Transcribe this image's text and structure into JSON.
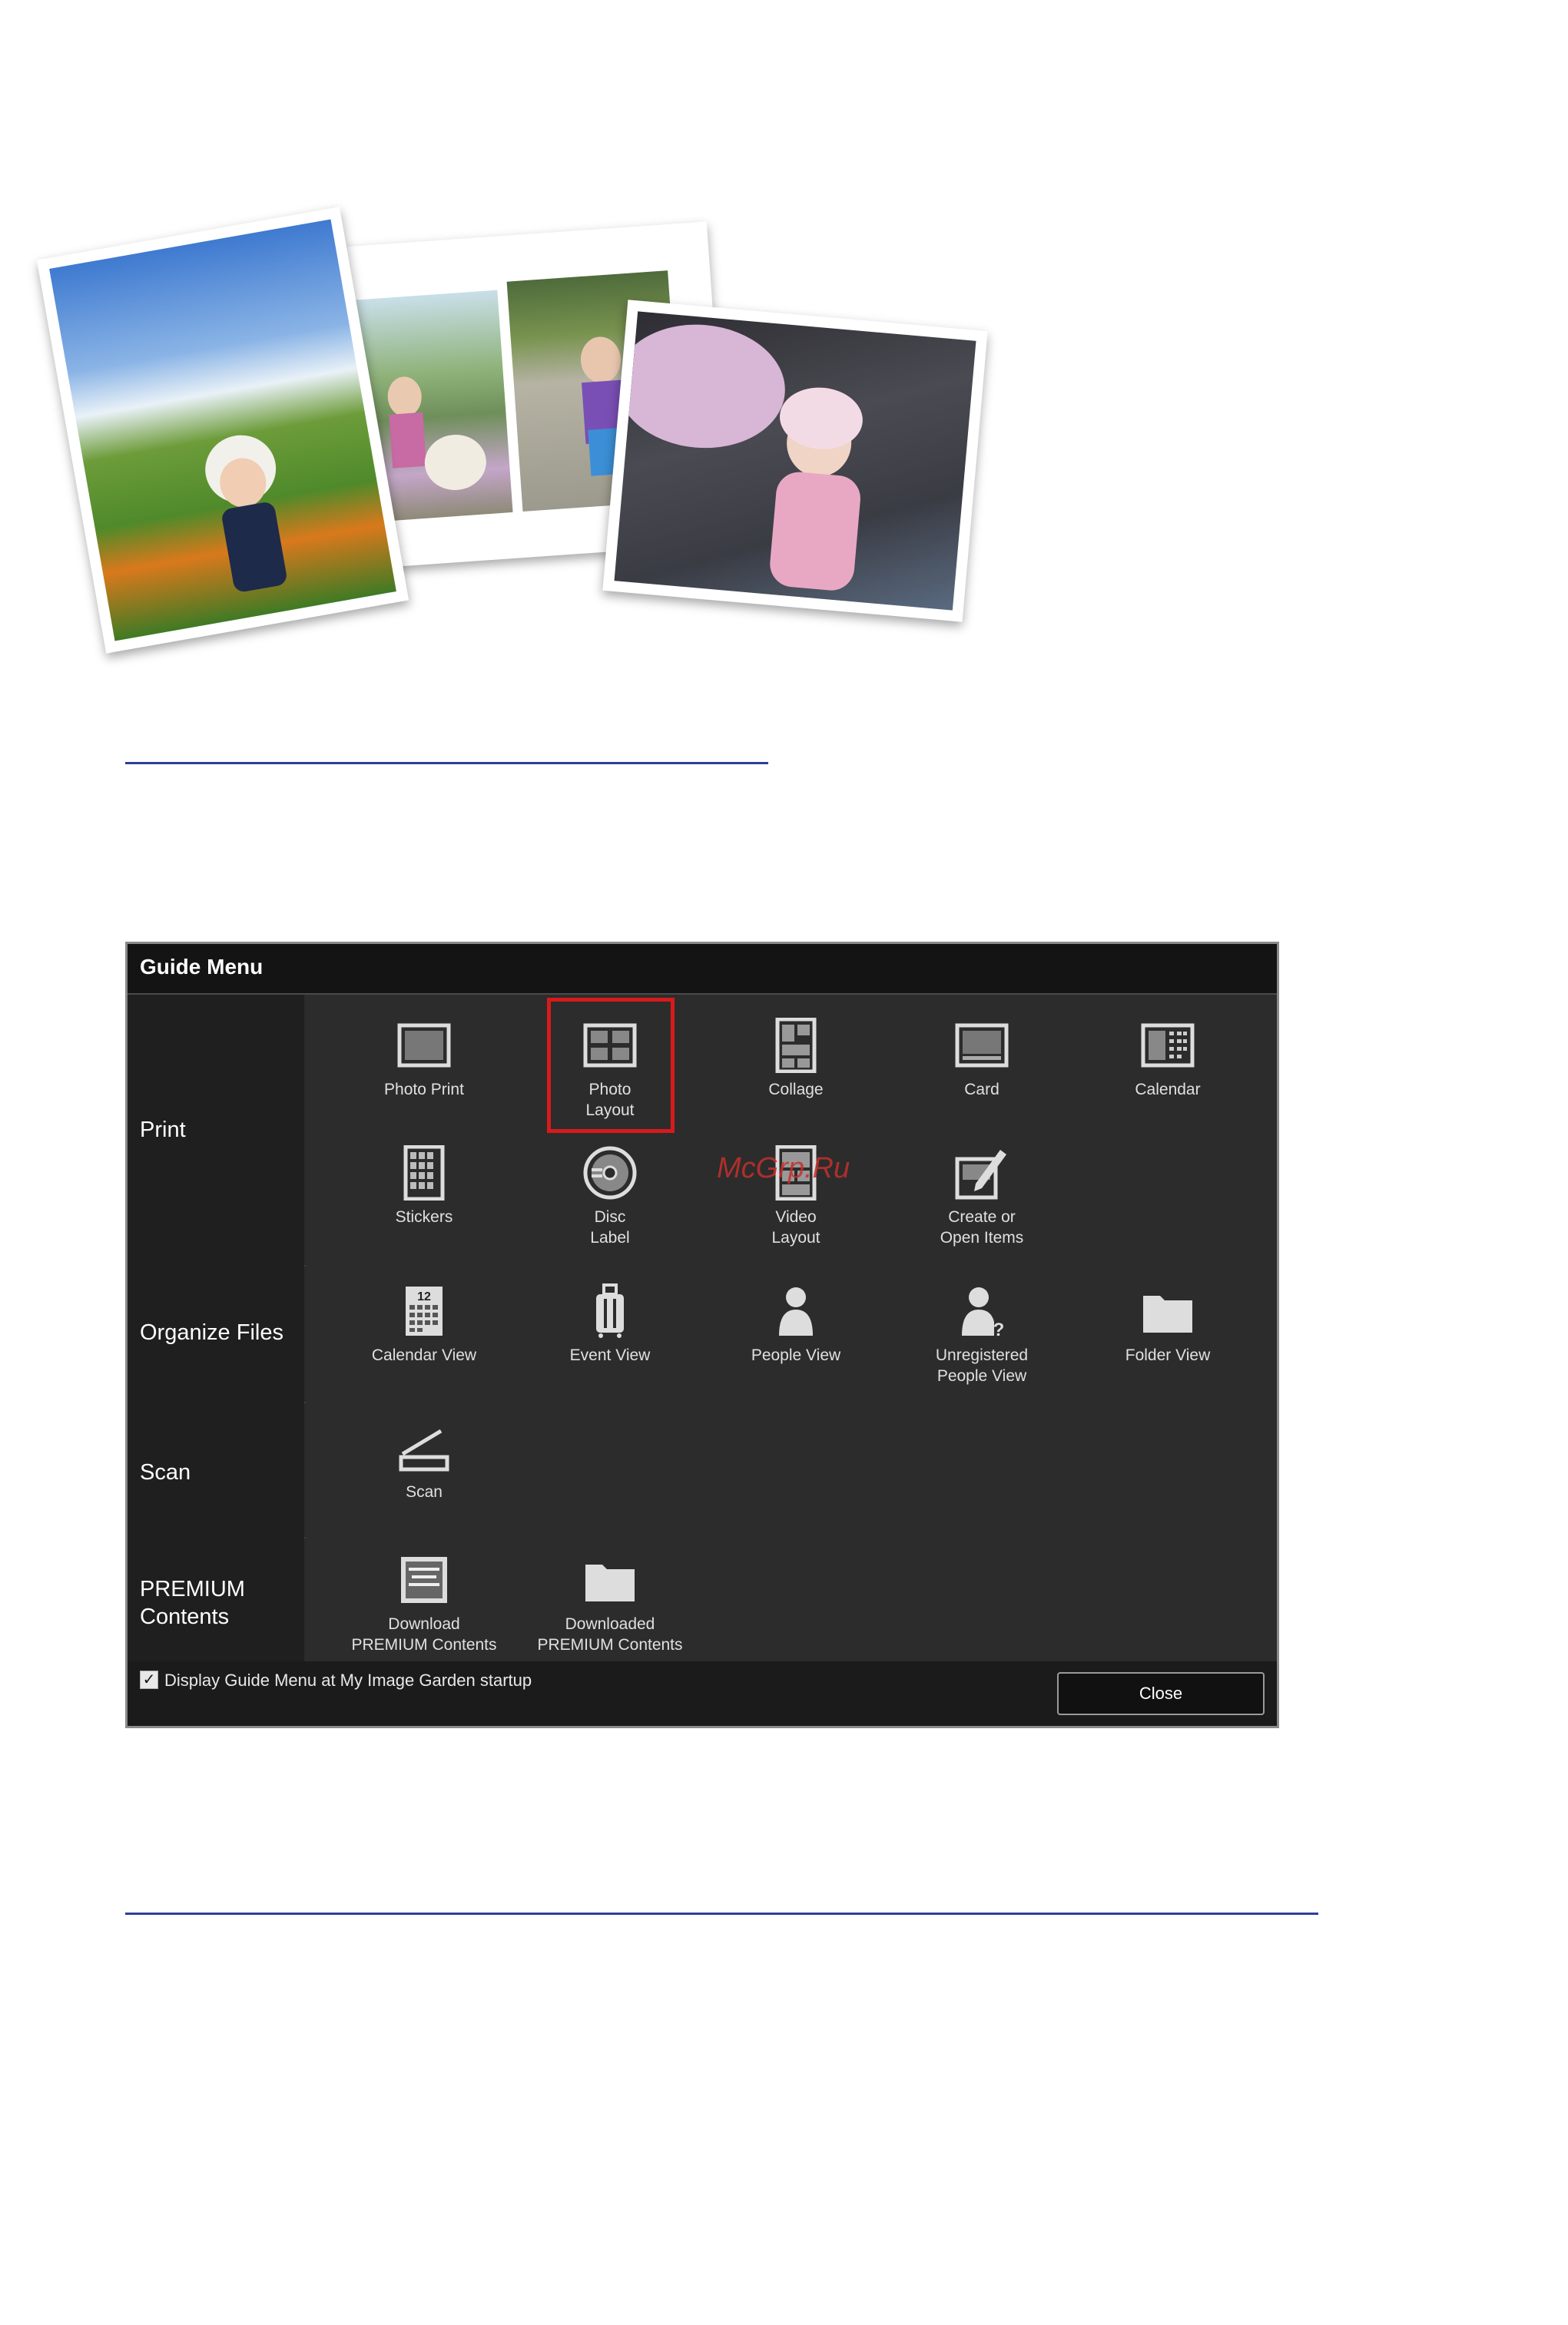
{
  "watermark": "McGrp.Ru",
  "guide_menu": {
    "title": "Guide Menu",
    "sections": {
      "print": {
        "label": "Print",
        "items": {
          "photo_print": "Photo Print",
          "photo_layout": "Photo\nLayout",
          "collage": "Collage",
          "card": "Card",
          "calendar": "Calendar",
          "stickers": "Stickers",
          "disc_label": "Disc\nLabel",
          "video_layout": "Video\nLayout",
          "create_open": "Create or\nOpen Items"
        }
      },
      "organize": {
        "label": "Organize Files",
        "items": {
          "calendar_view": "Calendar View",
          "calendar_day": "12",
          "event_view": "Event View",
          "people_view": "People View",
          "unregistered": "Unregistered\nPeople View",
          "folder_view": "Folder View"
        }
      },
      "scan": {
        "label": "Scan",
        "items": {
          "scan": "Scan"
        }
      },
      "premium": {
        "label": "PREMIUM\nContents",
        "items": {
          "download": "Download\nPREMIUM Contents",
          "downloaded": "Downloaded\nPREMIUM Contents"
        }
      }
    },
    "footer": {
      "checkbox_checked": true,
      "checkbox_label": "Display Guide Menu at My Image Garden startup",
      "close_label": "Close"
    }
  },
  "colors": {
    "highlight": "#d81a1a",
    "link_rule": "#2b3f9c"
  }
}
